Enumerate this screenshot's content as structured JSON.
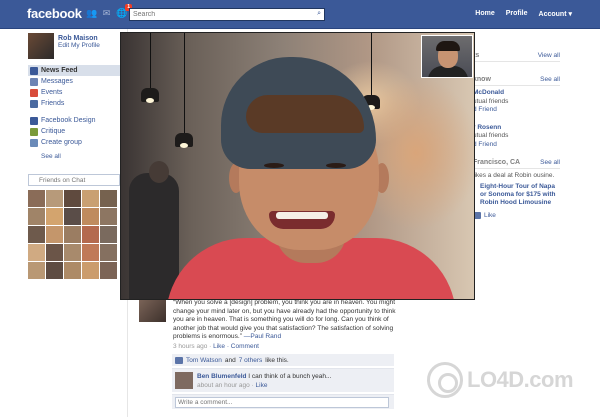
{
  "header": {
    "logo": "facebook",
    "notification_count": "1",
    "search_placeholder": "Search",
    "nav": [
      "Home",
      "Profile",
      "Account ▾"
    ]
  },
  "profile": {
    "name": "Rob Maison",
    "edit": "Edit My Profile"
  },
  "sidebar": {
    "items": [
      {
        "label": "News Feed",
        "icon": "news-feed-icon",
        "color": "#3b5998"
      },
      {
        "label": "Messages",
        "icon": "messages-icon",
        "color": "#6d84b4"
      },
      {
        "label": "Events",
        "icon": "events-icon",
        "color": "#d84c3a"
      },
      {
        "label": "Friends",
        "icon": "friends-icon",
        "color": "#4a6aa0"
      }
    ],
    "apps": [
      {
        "label": "Facebook Design",
        "icon": "design-icon",
        "color": "#3b5998"
      },
      {
        "label": "Critique",
        "icon": "critique-icon",
        "color": "#7a9a3a"
      },
      {
        "label": "Create group",
        "icon": "group-icon",
        "color": "#6a8ab8"
      }
    ],
    "see_all": "See all",
    "chat_placeholder": "Friends on Chat"
  },
  "right": {
    "events_see_all": "View all",
    "people_head": "know",
    "people_see_all": "See all",
    "people": [
      {
        "name": "McDonald",
        "sub": "utual friends",
        "action": "d Friend"
      },
      {
        "name": "r Rosenn",
        "sub": "utual friends",
        "action": "d Friend"
      }
    ],
    "deals_head": "Francisco, CA",
    "deals_see_all": "See all",
    "deal_intro": "likes a deal at Robin ousine.",
    "deal_title": "Eight-Hour Tour of Napa or Sonoma for $175 with Robin Hood Limousine",
    "deal_action": "Like"
  },
  "post": {
    "quote": "“When you solve a [design] problem, you think you are in heaven. You might change your mind later on, but you have already had the opportunity to think you are in heaven. That is something you will do for long. Can you think of another job that would give you that satisfaction? The satisfaction of solving problems is enormous.”",
    "author": "—Paul Rand",
    "time": "3 hours ago · ",
    "actions": "Like · Comment",
    "likes_name": "Tom Watson",
    "likes_and": "and",
    "likes_others": "7 others",
    "likes_tail": "like this.",
    "comment_author": "Ben Blumenfeld",
    "comment_text": "I can think of a bunch yeah...",
    "comment_time": "about an hour ago · ",
    "comment_like": "Like",
    "comment_placeholder": "Write a comment..."
  },
  "watermark": "LO4D.com"
}
